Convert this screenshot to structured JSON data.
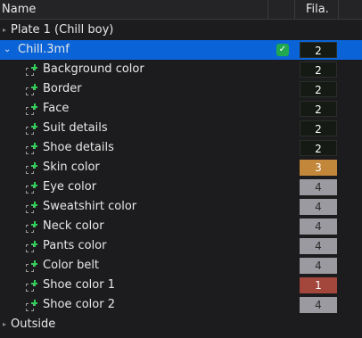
{
  "header": {
    "name": "Name",
    "filament": "Fila."
  },
  "plate": {
    "label": "Plate 1 (Chill boy)"
  },
  "object": {
    "label": "Chill.3mf",
    "filament": "2"
  },
  "parts": [
    {
      "label": "Background color",
      "filament": "2",
      "color": "#161a15"
    },
    {
      "label": "Border",
      "filament": "2",
      "color": "#161a15"
    },
    {
      "label": "Face",
      "filament": "2",
      "color": "#161a15"
    },
    {
      "label": "Suit details",
      "filament": "2",
      "color": "#161a15"
    },
    {
      "label": "Shoe details",
      "filament": "2",
      "color": "#161a15"
    },
    {
      "label": "Skin color",
      "filament": "3",
      "color": "#c2873b"
    },
    {
      "label": "Eye color",
      "filament": "4",
      "color": "#9b9aa0"
    },
    {
      "label": "Sweatshirt color",
      "filament": "4",
      "color": "#9b9aa0"
    },
    {
      "label": "Neck color",
      "filament": "4",
      "color": "#9b9aa0"
    },
    {
      "label": "Pants color",
      "filament": "4",
      "color": "#9b9aa0"
    },
    {
      "label": "Color belt",
      "filament": "4",
      "color": "#9b9aa0"
    },
    {
      "label": "Shoe color 1",
      "filament": "1",
      "color": "#a3463c"
    },
    {
      "label": "Shoe color 2",
      "filament": "4",
      "color": "#9b9aa0"
    }
  ],
  "outside": {
    "label": "Outside"
  },
  "colors": {
    "selection": "#0a64d8",
    "ok": "#1fa84f",
    "part_plus": "#2fcf58"
  }
}
